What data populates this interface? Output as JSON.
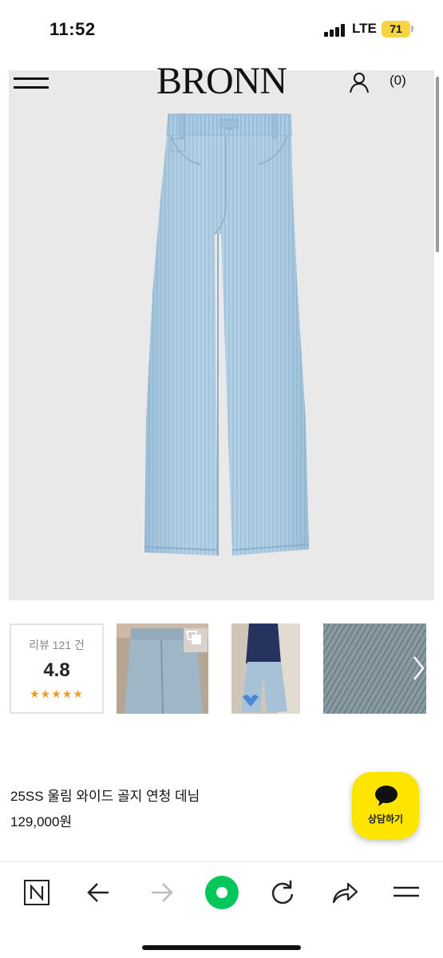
{
  "status_bar": {
    "time": "11:52",
    "network": "LTE",
    "battery": "71"
  },
  "header": {
    "brand": "BRONN",
    "cart_count": "(0)",
    "icons": [
      "menu-icon",
      "user-icon"
    ]
  },
  "reviews": {
    "count_label": "리뷰 121 건",
    "score": "4.8",
    "stars": "★★★★★"
  },
  "product": {
    "name": "25SS 울림 와이드 골지 연청 데님",
    "price": "129,000원"
  },
  "chat_button": {
    "label": "상담하기"
  },
  "bottom_nav": {
    "icons": [
      "naver-home-icon",
      "back-arrow-icon",
      "forward-arrow-icon",
      "green-dot-icon",
      "refresh-icon",
      "share-icon",
      "menu-icon"
    ]
  },
  "colors": {
    "hero_bg": "#e9e9e9",
    "denim": "#a9cbe3",
    "chat_yellow": "#fde500",
    "star_orange": "#f39a1f",
    "battery_yellow": "#f7d542",
    "nav_green": "#03c75a"
  }
}
